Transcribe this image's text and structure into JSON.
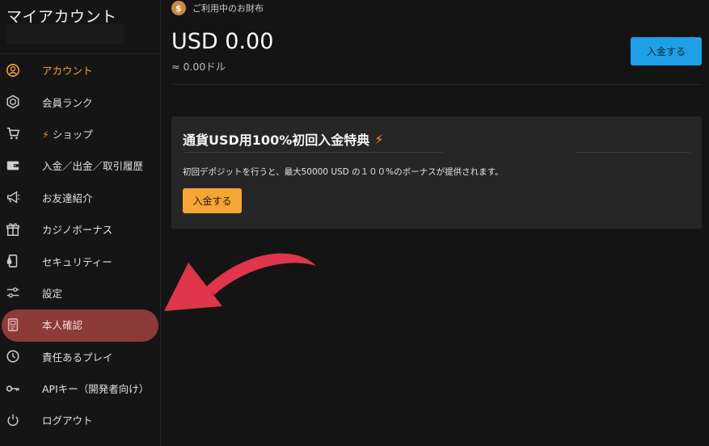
{
  "sidebar": {
    "title": "マイアカウント",
    "items": [
      {
        "label": "アカウント",
        "icon": "account-circle-icon"
      },
      {
        "label": "会員ランク",
        "icon": "hexagon-badge-icon"
      },
      {
        "label": "ショップ",
        "icon": "cart-icon"
      },
      {
        "label": "入金／出金／取引履歴",
        "icon": "wallet-icon"
      },
      {
        "label": "お友達紹介",
        "icon": "megaphone-icon"
      },
      {
        "label": "カジノボーナス",
        "icon": "gift-icon"
      },
      {
        "label": "セキュリティー",
        "icon": "phone-lock-icon"
      },
      {
        "label": "設定",
        "icon": "sliders-icon"
      },
      {
        "label": "本人確認",
        "icon": "id-document-icon"
      },
      {
        "label": "責任あるプレイ",
        "icon": "history-icon"
      },
      {
        "label": "APIキー（開発者向け）",
        "icon": "key-icon"
      },
      {
        "label": "ログアウト",
        "icon": "power-icon"
      }
    ]
  },
  "wallet": {
    "label": "ご利用中のお財布",
    "coin_symbol": "$",
    "balance": "USD 0.00",
    "converted": "≈ 0.00ドル",
    "deposit_button": "入金する"
  },
  "promo": {
    "title": "通貨USD用100%初回入金特典",
    "description": "初回デポジットを行うと、最大50000 USD の１００%のボーナスが提供されます。",
    "button": "入金する"
  },
  "colors": {
    "accent_orange": "#f0a13a",
    "highlight_red": "#8c3a3a",
    "deposit_blue": "#1ea0e8",
    "promo_button": "#f5a533",
    "arrow_red": "#e0354a"
  }
}
